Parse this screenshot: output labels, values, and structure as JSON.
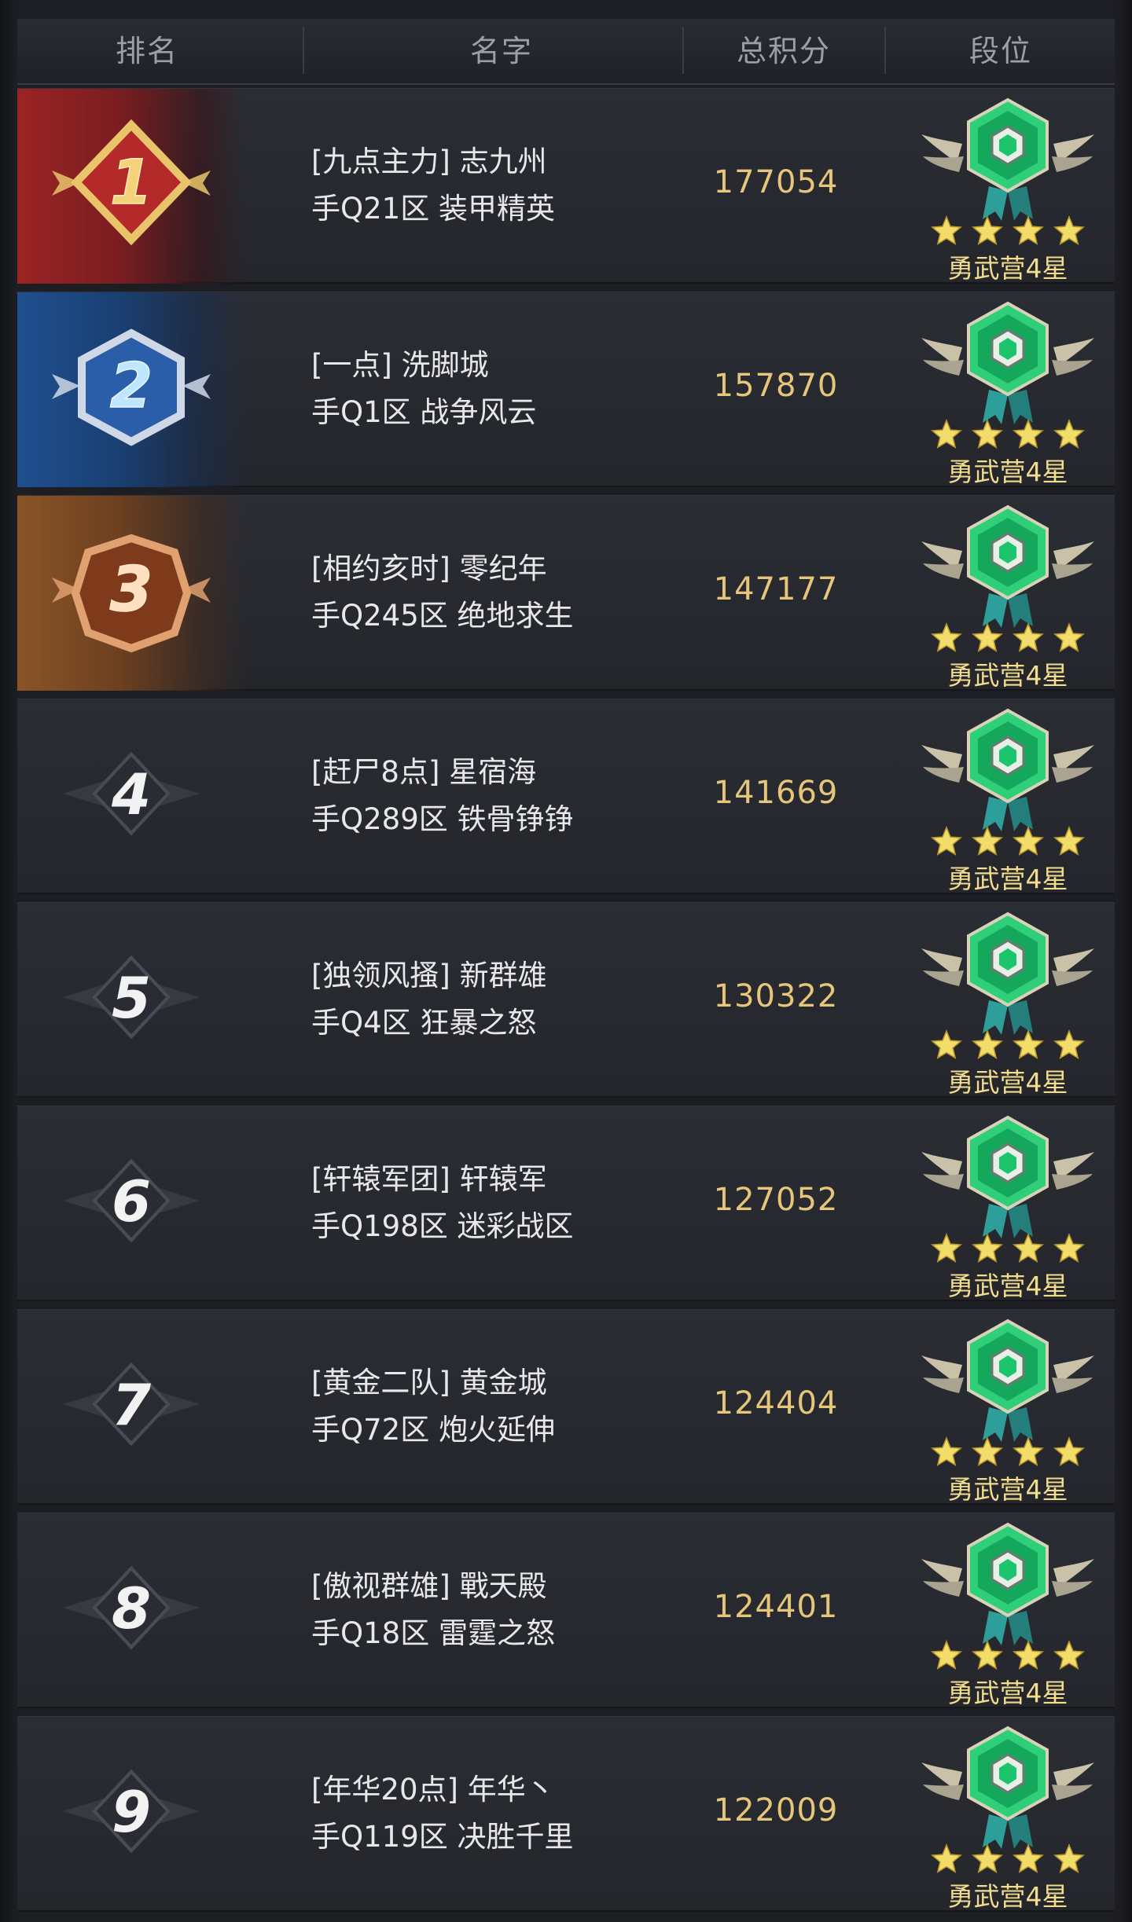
{
  "header": {
    "rank": "排名",
    "name": "名字",
    "score": "总积分",
    "tier": "段位"
  },
  "rows": [
    {
      "rank": "1",
      "line1": "[九点主力] 志九州",
      "line2": "手Q21区 装甲精英",
      "score": "177054",
      "tier": "勇武营4星"
    },
    {
      "rank": "2",
      "line1": "[一点] 洗脚城",
      "line2": "手Q1区 战争风云",
      "score": "157870",
      "tier": "勇武营4星"
    },
    {
      "rank": "3",
      "line1": "[相约亥时] 零纪年",
      "line2": "手Q245区 绝地求生",
      "score": "147177",
      "tier": "勇武营4星"
    },
    {
      "rank": "4",
      "line1": "[赶尸8点] 星宿海",
      "line2": "手Q289区 铁骨铮铮",
      "score": "141669",
      "tier": "勇武营4星"
    },
    {
      "rank": "5",
      "line1": "[独领风搔] 新群雄",
      "line2": "手Q4区 狂暴之怒",
      "score": "130322",
      "tier": "勇武营4星"
    },
    {
      "rank": "6",
      "line1": "[轩辕军团] 轩辕军",
      "line2": "手Q198区 迷彩战区",
      "score": "127052",
      "tier": "勇武营4星"
    },
    {
      "rank": "7",
      "line1": "[黄金二队] 黄金城",
      "line2": "手Q72区 炮火延伸",
      "score": "124404",
      "tier": "勇武营4星"
    },
    {
      "rank": "8",
      "line1": "[傲视群雄] 戰天殿",
      "line2": "手Q18区 雷霆之怒",
      "score": "124401",
      "tier": "勇武营4星"
    },
    {
      "rank": "9",
      "line1": "[年华20点] 年华丶",
      "line2": "手Q119区 决胜千里",
      "score": "122009",
      "tier": "勇武营4星"
    }
  ],
  "colors": {
    "gold_text": "#e5c67a",
    "tier_text": "#f2dd8e",
    "rank1": "#9a2424",
    "rank2": "#1f4f8f",
    "rank3": "#8a5426",
    "emerald": "#2fcf7a"
  },
  "icons": {
    "rank_top": "medal-badge-icon",
    "rank_other": "wing-chevron-icon",
    "tier": "emerald-shield-icon",
    "star": "star-icon"
  }
}
